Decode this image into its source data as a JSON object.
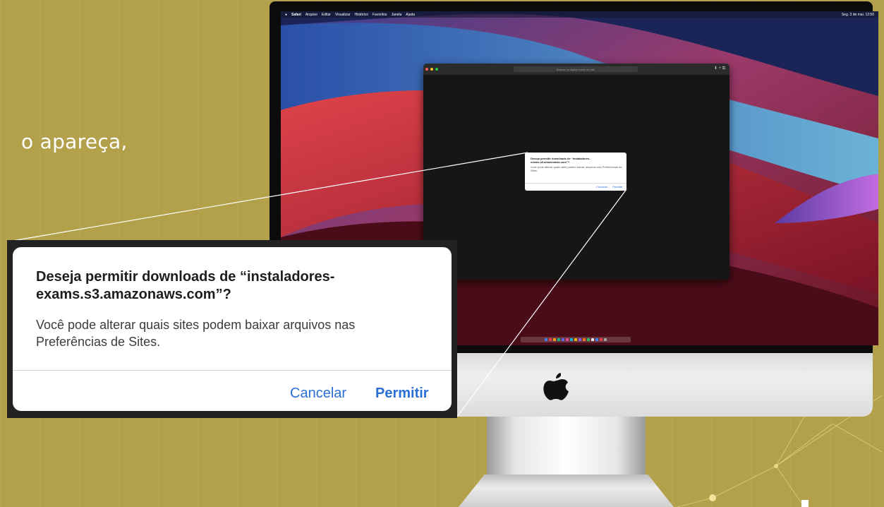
{
  "slide": {
    "partial_text": "o apareça,",
    "background_color": "#b3a04a"
  },
  "menubar": {
    "app_menu": "Safari",
    "items": [
      "Arquivo",
      "Editar",
      "Visualizar",
      "Histórico",
      "Favoritos",
      "Janela",
      "Ajuda"
    ],
    "clock": "Seg. 3 de mai. 12:50"
  },
  "safari": {
    "address_placeholder": "Buscar ou digitar nome do site",
    "mini_dialog": {
      "title": "Deseja permitir downloads de “instaladores-exams.s3.amazonaws.com”?",
      "body": "Você pode alterar quais sites podem baixar arquivos nas Preferências de Sites.",
      "cancel": "Cancelar",
      "allow": "Permitir"
    }
  },
  "dialog": {
    "title_line1": "Deseja permitir downloads de “instaladores-",
    "title_line2": "exams.s3.amazonaws.com”?",
    "body_line1": "Você pode alterar quais sites podem baixar arquivos nas",
    "body_line2": "Preferências de Sites.",
    "cancel_label": "Cancelar",
    "allow_label": "Permitir",
    "accent_color": "#2a6fd6"
  }
}
